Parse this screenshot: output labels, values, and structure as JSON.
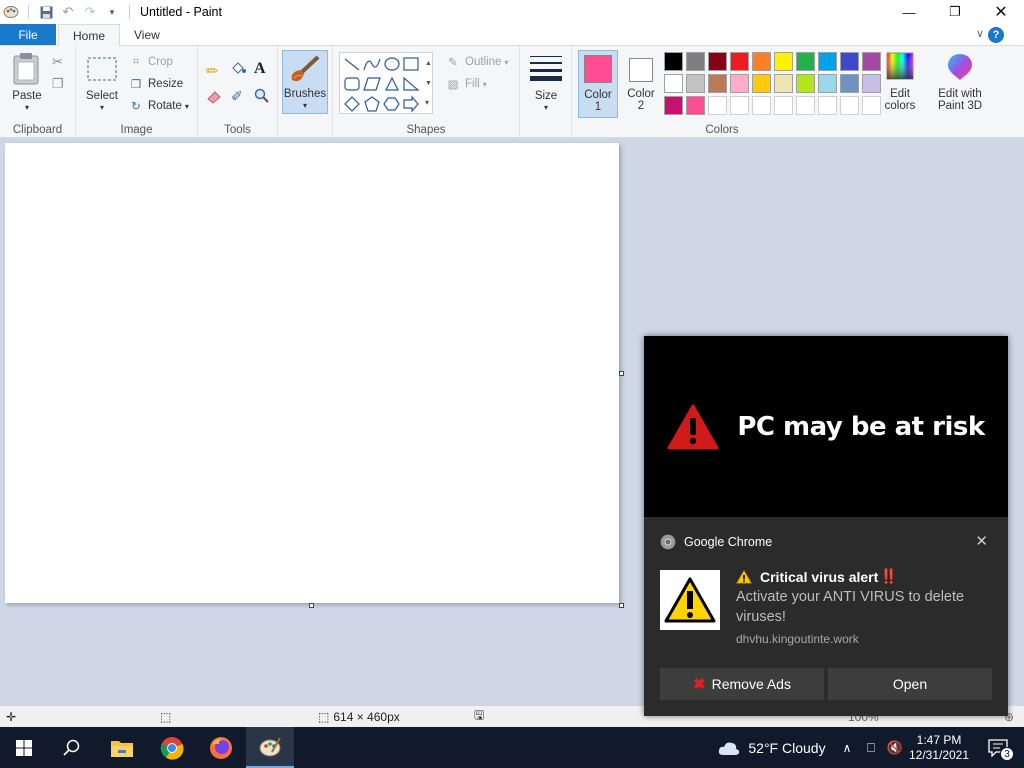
{
  "window": {
    "title": "Untitled - Paint"
  },
  "tabs": {
    "file": "File",
    "home": "Home",
    "view": "View"
  },
  "help": "?",
  "clipboard": {
    "paste": "Paste",
    "label": "Clipboard"
  },
  "image": {
    "select": "Select",
    "crop": "Crop",
    "resize": "Resize",
    "rotate": "Rotate",
    "label": "Image"
  },
  "tools": {
    "label": "Tools",
    "brushes": "Brushes",
    "text_icon": "A"
  },
  "shapes": {
    "outline": "Outline",
    "fill": "Fill",
    "label": "Shapes"
  },
  "size": {
    "label": "Size"
  },
  "colors": {
    "color1_label": "Color",
    "color1_num": "1",
    "color2_label": "Color",
    "color2_num": "2",
    "edit_colors_1": "Edit",
    "edit_colors_2": "colors",
    "paint3d_1": "Edit with",
    "paint3d_2": "Paint 3D",
    "label": "Colors",
    "color1": "#ff4d94",
    "color2": "#ffffff",
    "row1": [
      "#000000",
      "#7f7f7f",
      "#880015",
      "#ed1c24",
      "#ff7f27",
      "#fff200",
      "#22b14c",
      "#00a2e8",
      "#3f48cc",
      "#a349a4"
    ],
    "row2": [
      "#ffffff",
      "#c3c3c3",
      "#b97a57",
      "#ffaec9",
      "#ffc90e",
      "#efe4b0",
      "#b5e61d",
      "#99d9ea",
      "#7092be",
      "#c8bfe7"
    ],
    "row3": [
      "#c8106e",
      "#ff4d94"
    ]
  },
  "status": {
    "canvas_size": "614 × 460px",
    "zoom": "100%"
  },
  "notification": {
    "hero_text": "PC may be at risk",
    "app_name": "Google Chrome",
    "title": "Critical virus alert",
    "title_emoji": "‼️",
    "body": "Activate your ANTI VIRUS to delete viruses!",
    "source": "dhvhu.kingoutinte.work",
    "btn_remove": "Remove Ads",
    "btn_open": "Open"
  },
  "taskbar": {
    "weather": "52°F  Cloudy",
    "time": "1:47 PM",
    "date": "12/31/2021",
    "notif_count": "3"
  }
}
